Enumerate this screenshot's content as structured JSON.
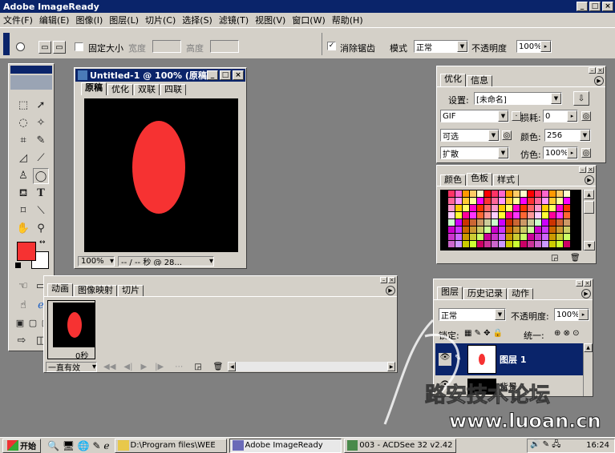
{
  "app": {
    "title": "Adobe ImageReady",
    "win_buttons": [
      "_",
      "□",
      "×"
    ]
  },
  "menu": [
    "文件(F)",
    "编辑(E)",
    "图像(I)",
    "图层(L)",
    "切片(C)",
    "选择(S)",
    "滤镜(T)",
    "视图(V)",
    "窗口(W)",
    "帮助(H)"
  ],
  "options": {
    "fixed_size": "固定大小",
    "width_label": "宽度",
    "height_label": "高度",
    "antialias": "消除锯齿",
    "mode_label": "模式",
    "mode_value": "正常",
    "opacity_label": "不透明度",
    "opacity_value": "100%"
  },
  "doc": {
    "title": "Untitled-1 @ 100% (原稿)",
    "tabs": [
      "原稿",
      "优化",
      "双联",
      "四联"
    ],
    "zoom": "100%",
    "status": "-- / -- 秒 @ 28...",
    "colors": {
      "canvas": "#000000",
      "ellipse": "#f63232"
    }
  },
  "optimize": {
    "tabs": [
      "优化",
      "信息"
    ],
    "settings_label": "设置:",
    "settings_value": "[未命名]",
    "format": "GIF",
    "lossy_label": "损耗:",
    "lossy_value": "0",
    "palette": "可选",
    "colors_label": "颜色:",
    "colors_value": "256",
    "dither": "扩散",
    "dither_label": "仿色:",
    "dither_value": "100%"
  },
  "swatches": {
    "tabs": [
      "颜色",
      "色板",
      "样式"
    ]
  },
  "layers": {
    "tabs": [
      "图层",
      "历史记录",
      "动作"
    ],
    "blend": "正常",
    "opacity_label": "不透明度:",
    "opacity_value": "100%",
    "lock_label": "锁定:",
    "unify_label": "统一:",
    "items": [
      {
        "name": "图层 1"
      },
      {
        "name": "背景"
      }
    ]
  },
  "animation": {
    "tabs": [
      "动画",
      "图像映射",
      "切片"
    ],
    "frame_time": "0秒",
    "loop": "一直有效"
  },
  "taskbar": {
    "start": "开始",
    "tasks": [
      "D:\\Program files\\WEE",
      "Adobe ImageReady",
      "003 - ACDSee 32 v2.42"
    ],
    "clock": "16:24"
  },
  "watermark": "www.luoan.cn",
  "colors": {
    "title_active": "#0a246a",
    "fg_color": "#f63232",
    "bg_color": "#ffffff"
  }
}
